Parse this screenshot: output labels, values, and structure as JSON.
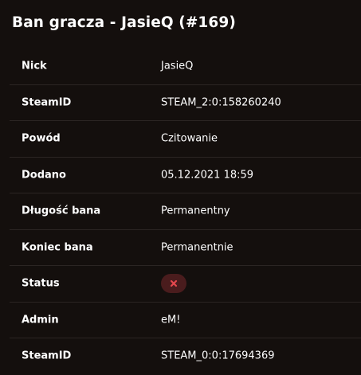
{
  "title": "Ban gracza - JasieQ (#169)",
  "rows": [
    {
      "label": "Nick",
      "value": "JasieQ"
    },
    {
      "label": "SteamID",
      "value": "STEAM_2:0:158260240"
    },
    {
      "label": "Powód",
      "value": "Czitowanie"
    },
    {
      "label": "Dodano",
      "value": "05.12.2021 18:59"
    },
    {
      "label": "Długość bana",
      "value": "Permanentny"
    },
    {
      "label": "Koniec bana",
      "value": "Permanentnie"
    },
    {
      "label": "Status",
      "icon": "x-icon"
    },
    {
      "label": "Admin",
      "value": "eM!"
    },
    {
      "label": "SteamID",
      "value": "STEAM_0:0:17694369"
    }
  ],
  "colors": {
    "background": "#140f0d",
    "divider": "#2b2523",
    "status_badge_bg": "#4a1c1d",
    "status_icon": "#e5484d"
  }
}
